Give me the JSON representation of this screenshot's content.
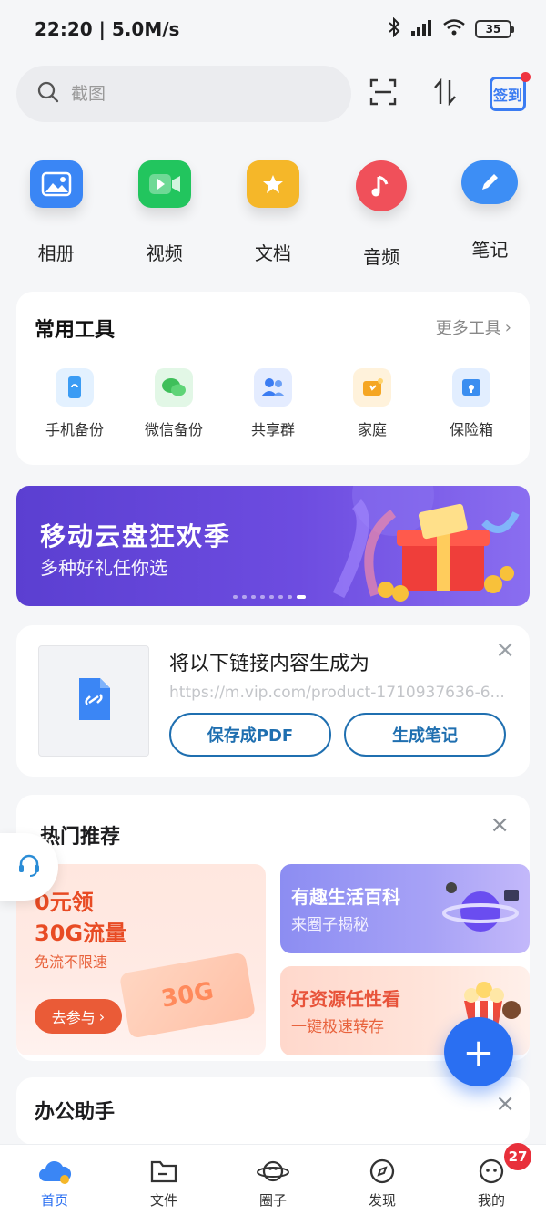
{
  "status_bar": {
    "time": "22:20",
    "speed": "5.0M/s",
    "battery": "35"
  },
  "search": {
    "placeholder": "截图"
  },
  "header": {
    "signin_label": "签到"
  },
  "quick_access": [
    {
      "label": "相册",
      "icon": "photo-album-icon",
      "color": "#3a86f5"
    },
    {
      "label": "视频",
      "icon": "video-icon",
      "color": "#22c55e"
    },
    {
      "label": "文档",
      "icon": "document-icon",
      "color": "#f5b729"
    },
    {
      "label": "音频",
      "icon": "music-icon",
      "color": "#f0505a"
    },
    {
      "label": "笔记",
      "icon": "note-icon",
      "color": "#3d8ef5"
    }
  ],
  "tools": {
    "title": "常用工具",
    "more": "更多工具",
    "items": [
      {
        "label": "手机备份",
        "icon": "phone-backup-icon",
        "color": "#3b9cf4"
      },
      {
        "label": "微信备份",
        "icon": "wechat-backup-icon",
        "color": "#3fbf5a"
      },
      {
        "label": "共享群",
        "icon": "share-group-icon",
        "color": "#3b7cf2"
      },
      {
        "label": "家庭",
        "icon": "family-icon",
        "color": "#f5a623"
      },
      {
        "label": "保险箱",
        "icon": "safe-box-icon",
        "color": "#3b8ef0"
      }
    ]
  },
  "banner": {
    "title": "移动云盘狂欢季",
    "subtitle": "多种好礼任你选"
  },
  "link_card": {
    "title": "将以下链接内容生成为",
    "url": "https://m.vip.com/product-1710937636-6...",
    "button_pdf": "保存成PDF",
    "button_note": "生成笔记"
  },
  "hot": {
    "title": "热门推荐",
    "promo_left": {
      "line1": "0元领",
      "line2": "30G流量",
      "line3": "免流不限速",
      "button": "去参与",
      "ticket": "30G"
    },
    "promo_r1": {
      "title": "有趣生活百科",
      "sub": "来圈子揭秘"
    },
    "promo_r2": {
      "title": "好资源任性看",
      "sub": "一键极速转存"
    }
  },
  "office": {
    "title": "办公助手"
  },
  "bottom_nav": [
    {
      "label": "首页",
      "icon": "cloud-home-icon",
      "active": true
    },
    {
      "label": "文件",
      "icon": "folder-icon",
      "active": false
    },
    {
      "label": "圈子",
      "icon": "planet-icon",
      "active": false
    },
    {
      "label": "发现",
      "icon": "compass-icon",
      "active": false
    },
    {
      "label": "我的",
      "icon": "profile-icon",
      "active": false,
      "badge": "27"
    }
  ],
  "colors": {
    "accent": "#2a6ff2",
    "banner": "#5b3fd1",
    "promo_orange": "#e84b24"
  }
}
